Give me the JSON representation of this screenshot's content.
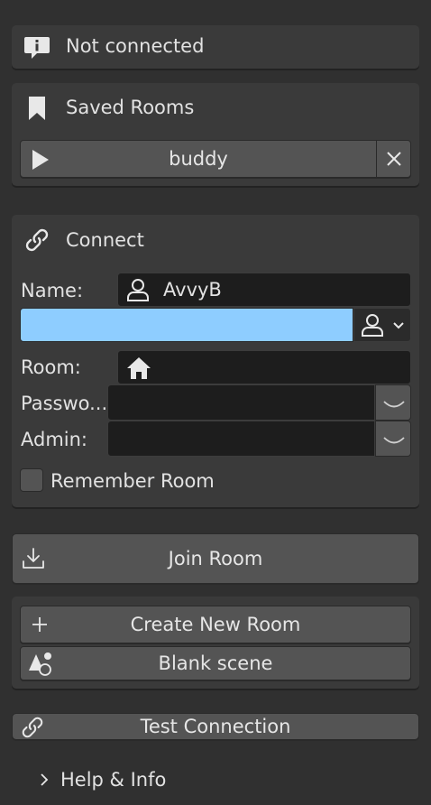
{
  "status": {
    "text": "Not connected",
    "icon": "info-icon"
  },
  "saved_rooms": {
    "title": "Saved Rooms",
    "room_button": "buddy"
  },
  "connect": {
    "title": "Connect",
    "name_label": "Name:",
    "name_value": "AvvyB",
    "color_hex": "#8ecdff",
    "room_label": "Room:",
    "room_value": "",
    "password_label": "Passwo...",
    "password_value": "",
    "admin_label": "Admin:",
    "admin_value": "",
    "remember_label": "Remember Room",
    "remember_checked": false
  },
  "join_room": {
    "label": "Join Room"
  },
  "create": {
    "create_label": "Create New Room",
    "blank_label": "Blank scene"
  },
  "test_connection": {
    "label": "Test Connection"
  },
  "help": {
    "label": "Help & Info"
  }
}
